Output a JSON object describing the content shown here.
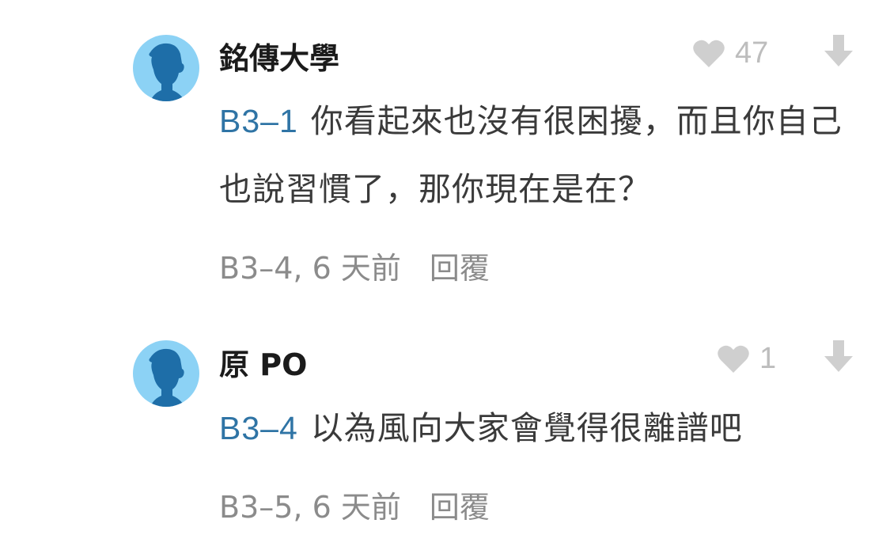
{
  "comments": [
    {
      "author": "銘傳大學",
      "likes": "47",
      "floor_tag": "B3–1",
      "text": "你看起來也沒有很困擾，而且你自己也說習慣了，那你現在是在？",
      "meta": "B3–4, 6 天前",
      "reply_label": "回覆"
    },
    {
      "author": "原 PO",
      "likes": "1",
      "floor_tag": "B3–4",
      "text": "以為風向大家會覺得很離譜吧",
      "meta": "B3–5, 6 天前",
      "reply_label": "回覆"
    }
  ],
  "colors": {
    "avatar_bg": "#8cd2f5",
    "avatar_silhouette": "#1e6ea8",
    "floor_tag": "#2f74a5",
    "icon_gray": "#cfcfcf"
  },
  "icons": {
    "like": "heart-icon",
    "downvote": "arrow-down-icon",
    "avatar": "default-avatar-silhouette"
  }
}
